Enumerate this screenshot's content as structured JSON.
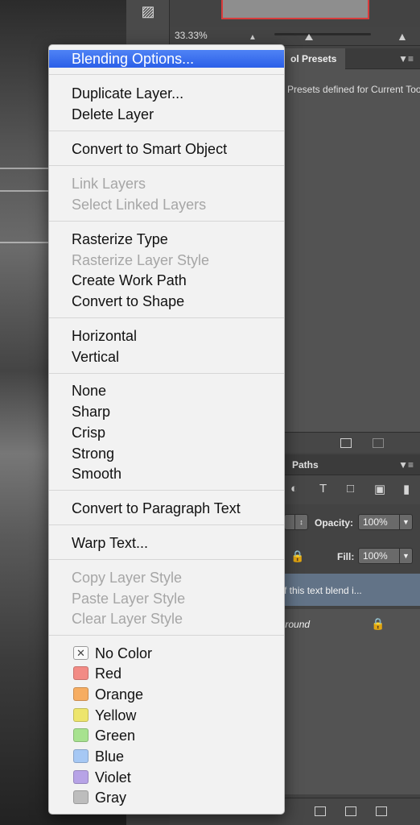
{
  "panel": {
    "zoom_value": "33.33%",
    "presets_tab": "ol Presets",
    "presets_message": "Presets defined for Current Tool.",
    "layers_paths_tab": "Paths",
    "opacity_label": "Opacity:",
    "opacity_value": "100%",
    "fill_label": "Fill:",
    "fill_value": "100%",
    "layer1_name": "Part of this text blend i...",
    "layer2_name": "Background",
    "panel_menu_icon": "panel-menu-icon"
  },
  "menu": {
    "items": [
      {
        "label": "Blending Options...",
        "enabled": true,
        "selected": true
      },
      {
        "label": "Duplicate Layer...",
        "enabled": true
      },
      {
        "label": "Delete Layer",
        "enabled": true
      },
      {
        "label": "Convert to Smart Object",
        "enabled": true
      },
      {
        "label": "Link Layers",
        "enabled": false
      },
      {
        "label": "Select Linked Layers",
        "enabled": false
      },
      {
        "label": "Rasterize Type",
        "enabled": true
      },
      {
        "label": "Rasterize Layer Style",
        "enabled": false
      },
      {
        "label": "Create Work Path",
        "enabled": true
      },
      {
        "label": "Convert to Shape",
        "enabled": true
      },
      {
        "label": "Horizontal",
        "enabled": true
      },
      {
        "label": "Vertical",
        "enabled": true
      },
      {
        "label": "None",
        "enabled": true
      },
      {
        "label": "Sharp",
        "enabled": true
      },
      {
        "label": "Crisp",
        "enabled": true
      },
      {
        "label": "Strong",
        "enabled": true
      },
      {
        "label": "Smooth",
        "enabled": true
      },
      {
        "label": "Convert to Paragraph Text",
        "enabled": true
      },
      {
        "label": "Warp Text...",
        "enabled": true
      },
      {
        "label": "Copy Layer Style",
        "enabled": false
      },
      {
        "label": "Paste Layer Style",
        "enabled": false
      },
      {
        "label": "Clear Layer Style",
        "enabled": false
      }
    ],
    "colors": [
      {
        "label": "No Color",
        "swatch": "none"
      },
      {
        "label": "Red",
        "swatch": "#f28b85"
      },
      {
        "label": "Orange",
        "swatch": "#f6ad62"
      },
      {
        "label": "Yellow",
        "swatch": "#ede56c"
      },
      {
        "label": "Green",
        "swatch": "#a7e28f"
      },
      {
        "label": "Blue",
        "swatch": "#a6c8f4"
      },
      {
        "label": "Violet",
        "swatch": "#b7a3e6"
      },
      {
        "label": "Gray",
        "swatch": "#bdbdbd"
      }
    ],
    "selection_color": "#2b5fe8",
    "disabled_color": "#a6a6a6"
  }
}
